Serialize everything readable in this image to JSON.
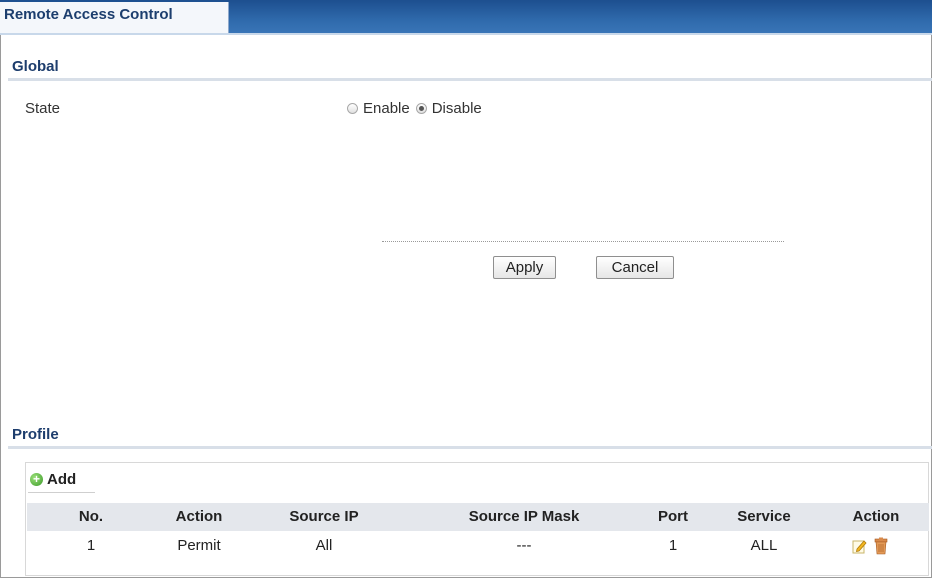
{
  "tab": {
    "label": "Remote Access Control"
  },
  "global": {
    "title": "Global",
    "state_label": "State",
    "options": [
      "Enable",
      "Disable"
    ],
    "selected": "Disable"
  },
  "buttons": {
    "apply": "Apply",
    "cancel": "Cancel"
  },
  "profile": {
    "title": "Profile",
    "add_label": "Add",
    "columns": [
      "No.",
      "Action",
      "Source IP",
      "Source IP Mask",
      "Port",
      "Service",
      "Action"
    ],
    "rows": [
      {
        "no": "1",
        "action": "Permit",
        "source_ip": "All",
        "source_ip_mask": "---",
        "port": "1",
        "service": "ALL"
      }
    ],
    "row_action_icons": [
      "edit-icon",
      "delete-icon"
    ]
  },
  "colors": {
    "tab_bar": "#2f6aac",
    "section_title": "#1d3d6d",
    "table_header": "#e4e7ec"
  }
}
